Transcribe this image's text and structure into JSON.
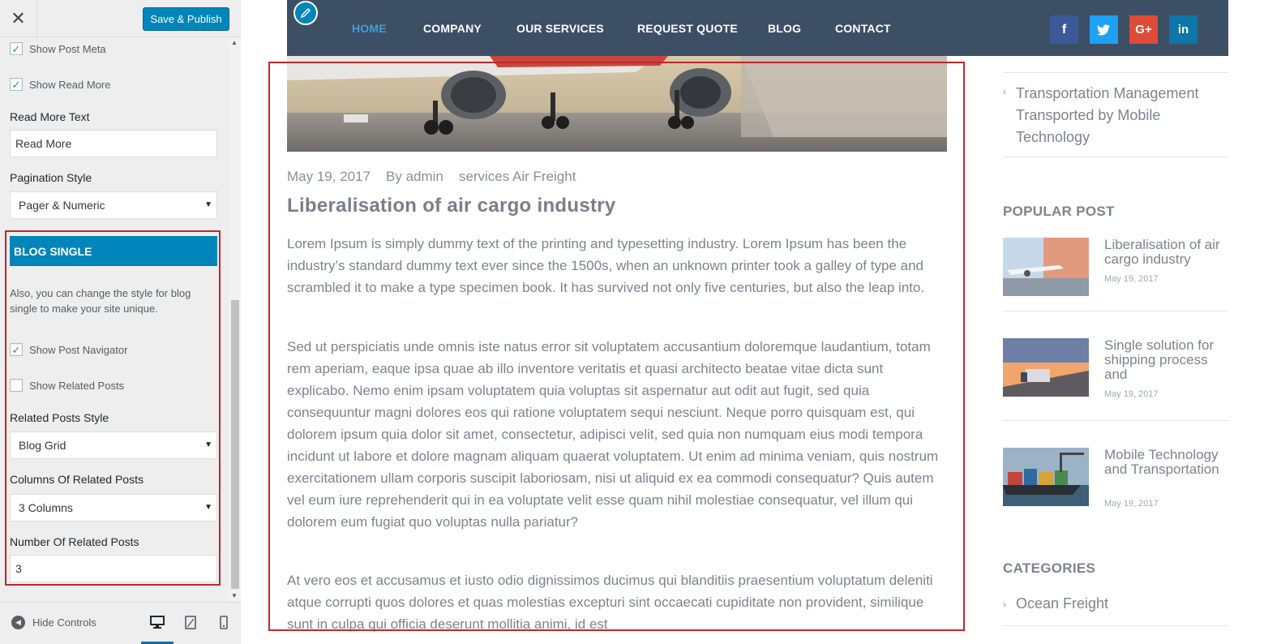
{
  "customizer": {
    "close_icon": "close-icon",
    "publish_label": "Save & Publish",
    "show_post_meta": {
      "label": "Show Post Meta",
      "checked": true
    },
    "show_read_more": {
      "label": "Show Read More",
      "checked": true
    },
    "read_more_text": {
      "label": "Read More Text",
      "value": "Read More"
    },
    "pagination_style": {
      "label": "Pagination Style",
      "value": "Pager & Numeric"
    },
    "blog_single": {
      "title": "BLOG SINGLE",
      "description": "Also, you can change the style for blog single to make your site unique.",
      "show_post_navigator": {
        "label": "Show Post Navigator",
        "checked": true
      },
      "show_related_posts": {
        "label": "Show Related Posts",
        "checked": false
      },
      "related_posts_style": {
        "label": "Related Posts Style",
        "value": "Blog Grid"
      },
      "columns_related": {
        "label": "Columns Of Related Posts",
        "value": "3 Columns"
      },
      "number_related": {
        "label": "Number Of Related Posts",
        "value": "3"
      }
    },
    "footer": {
      "hide_controls": "Hide Controls"
    },
    "colors": {
      "accent": "#0085ba",
      "highlight": "#c0272d"
    }
  },
  "site": {
    "nav": [
      "HOME",
      "COMPANY",
      "OUR SERVICES",
      "REQUEST QUOTE",
      "BLOG",
      "CONTACT"
    ],
    "active_nav": "HOME",
    "social": [
      {
        "icon": "facebook-icon",
        "glyph": "f",
        "color": "#3b5998"
      },
      {
        "icon": "twitter-icon",
        "glyph": "t",
        "color": "#1da1f2"
      },
      {
        "icon": "google-plus-icon",
        "glyph": "G+",
        "color": "#dd4b39"
      },
      {
        "icon": "linkedin-icon",
        "glyph": "in",
        "color": "#0e76a8"
      }
    ],
    "post": {
      "date": "May 19, 2017",
      "author": "By admin",
      "category": "services Air Freight",
      "title": "Liberalisation of air cargo industry",
      "paragraphs": [
        "Lorem Ipsum is simply dummy text of the printing and typesetting industry. Lorem Ipsum has been the industry’s standard dummy text ever since the 1500s, when an unknown printer took a galley of type and scrambled it to make a type specimen book. It has survived not only five centuries, but also the leap into.",
        "Sed ut perspiciatis unde omnis iste natus error sit voluptatem accusantium doloremque laudantium, totam rem aperiam, eaque ipsa quae ab illo inventore veritatis et quasi architecto beatae vitae dicta sunt explicabo. Nemo enim ipsam voluptatem quia voluptas sit aspernatur aut odit aut fugit, sed quia consequuntur magni dolores eos qui ratione voluptatem sequi nesciunt. Neque porro quisquam est, qui dolorem ipsum quia dolor sit amet, consectetur, adipisci velit, sed quia non numquam eius modi tempora incidunt ut labore et dolore magnam aliquam quaerat voluptatem. Ut enim ad minima veniam, quis nostrum exercitationem ullam corporis suscipit laboriosam, nisi ut aliquid ex ea commodi consequatur? Quis autem vel eum iure reprehenderit qui in ea voluptate velit esse quam nihil molestiae consequatur, vel illum qui dolorem eum fugiat quo voluptas nulla pariatur?",
        "At vero eos et accusamus et iusto odio dignissimos ducimus qui blanditiis praesentium voluptatum deleniti atque corrupti quos dolores et quas molestias excepturi sint occaecati cupiditate non provident, similique sunt in culpa qui officia deserunt mollitia animi, id est"
      ]
    },
    "sidebar": {
      "top_link": "Transportation Management Transported by Mobile Technology",
      "popular_title": "POPULAR POST",
      "popular": [
        {
          "title": "Liberalisation of air cargo industry",
          "date": "May 19, 2017"
        },
        {
          "title": "Single solution for shipping process and",
          "date": "May 19, 2017"
        },
        {
          "title": "Mobile Technology and Transportation",
          "date": "May 19, 2017"
        }
      ],
      "categories_title": "CATEGORIES",
      "categories": [
        "Ocean Freight"
      ]
    }
  }
}
